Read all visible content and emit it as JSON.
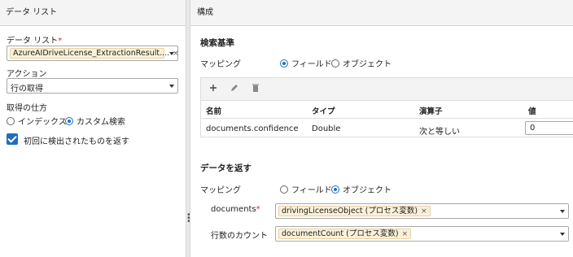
{
  "left_panel": {
    "title": "データ リスト",
    "data_list_label": "データ リスト",
    "required_mark": "*",
    "data_list_chip": "AzureAIDriveLicense_ExtractionResult....",
    "chip_close": "×",
    "action_label": "アクション",
    "action_value": "行の取得",
    "method_label": "取得の仕方",
    "method_options": [
      "インデックス",
      "カスタム検索"
    ],
    "method_selected": "カスタム検索",
    "return_first_label": "初回に検出されたものを返す",
    "return_first_checked": true
  },
  "right_panel": {
    "title": "構成",
    "search_criteria": {
      "title": "検索基準",
      "mapping_label": "マッピング",
      "mapping_options": [
        "フィールド",
        "オブジェクト"
      ],
      "mapping_selected": "フィールド",
      "toolbar": [
        "add-icon",
        "edit-icon",
        "delete-icon"
      ],
      "table": {
        "headers": [
          "名前",
          "タイプ",
          "演算子",
          "値"
        ],
        "rows": [
          {
            "name": "documents.confidence",
            "type": "Double",
            "operator": "次と等しい",
            "value": "0"
          }
        ]
      }
    },
    "return_data": {
      "title": "データを返す",
      "mapping_label": "マッピング",
      "mapping_options": [
        "フィールド",
        "オブジェクト"
      ],
      "mapping_selected": "オブジェクト",
      "documents_label": "documents",
      "documents_chip": "drivingLicenseObject (プロセス変数)",
      "row_count_label": "行数のカウント",
      "row_count_chip": "documentCount (プロセス変数)"
    }
  },
  "colors": {
    "accent": "#1f6fbf",
    "chip_bg": "#fbf1d9",
    "required": "#c0392b"
  }
}
